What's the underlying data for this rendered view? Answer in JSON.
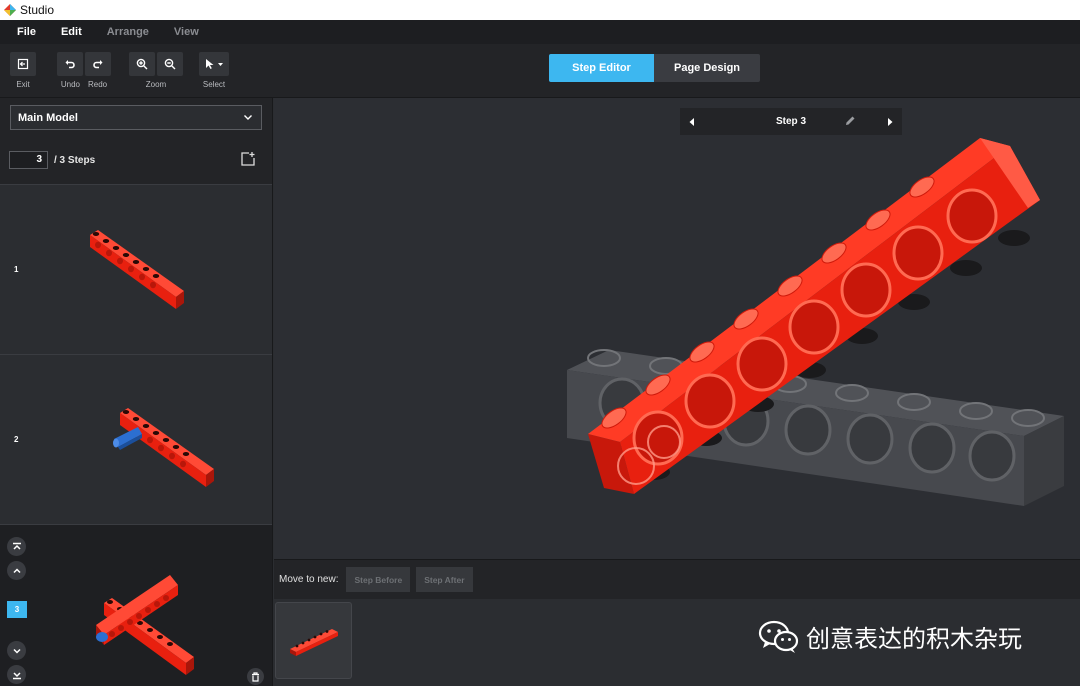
{
  "titlebar": {
    "title": "Studio"
  },
  "menu": {
    "items": [
      {
        "label": "File",
        "enabled": true
      },
      {
        "label": "Edit",
        "enabled": true
      },
      {
        "label": "Arrange",
        "enabled": false
      },
      {
        "label": "View",
        "enabled": false
      }
    ]
  },
  "toolbar": {
    "exit_label": "Exit",
    "undo_label": "Undo",
    "redo_label": "Redo",
    "zoom_label": "Zoom",
    "select_label": "Select"
  },
  "mode_tabs": {
    "active": "Step Editor",
    "inactive": "Page Design"
  },
  "sidebar": {
    "model_select": "Main Model",
    "current_step": "3",
    "steps_total_label": "/ 3 Steps",
    "steps": [
      {
        "number": "1"
      },
      {
        "number": "2"
      },
      {
        "number": "3"
      }
    ]
  },
  "viewport": {
    "step_title": "Step 3"
  },
  "movebar": {
    "label": "Move to new:",
    "step_before": "Step Before",
    "step_after": "Step After"
  },
  "watermark": {
    "text": "创意表达的积木杂玩"
  },
  "colors": {
    "accent": "#3db7f0",
    "brick_red": "#e8200f",
    "axle_blue": "#2c6fd1"
  },
  "icons": [
    "exit-icon",
    "undo-icon",
    "redo-icon",
    "zoom-in-icon",
    "zoom-out-icon",
    "select-arrow-icon",
    "chevron-down-icon",
    "add-step-icon",
    "pencil-icon",
    "trash-icon",
    "wechat-icon"
  ]
}
